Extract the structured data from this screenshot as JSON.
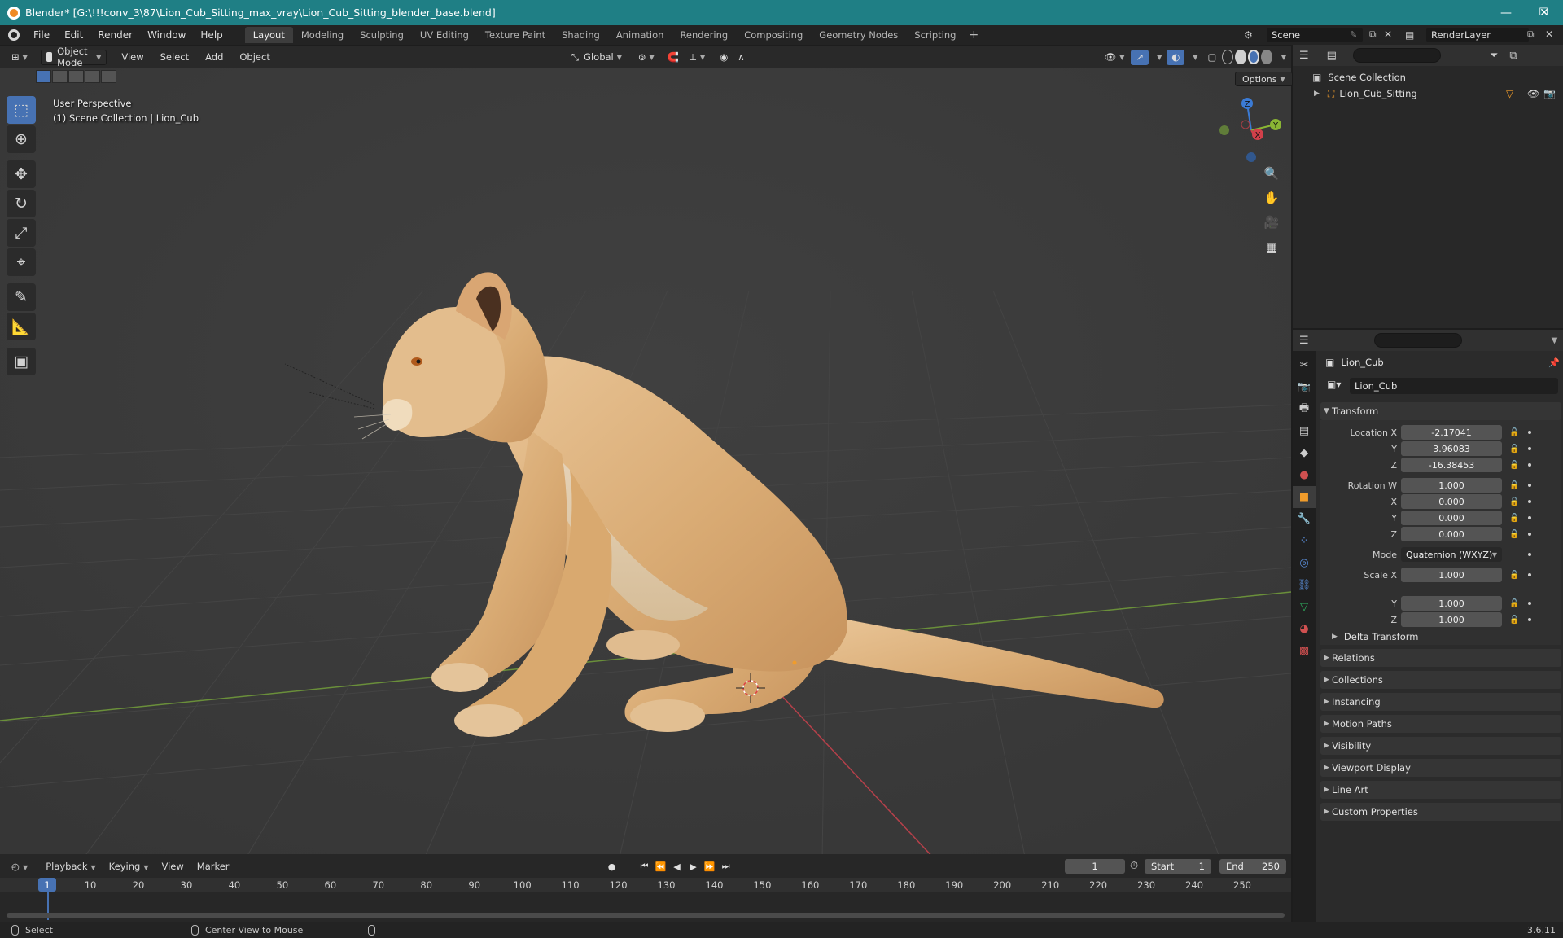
{
  "window": {
    "title": "Blender* [G:\\!!!conv_3\\87\\Lion_Cub_Sitting_max_vray\\Lion_Cub_Sitting_blender_base.blend]",
    "minimize": "—",
    "maximize": "☐",
    "close": "✕"
  },
  "menu": [
    "File",
    "Edit",
    "Render",
    "Window",
    "Help"
  ],
  "workspaces": [
    "Layout",
    "Modeling",
    "Sculpting",
    "UV Editing",
    "Texture Paint",
    "Shading",
    "Animation",
    "Rendering",
    "Compositing",
    "Geometry Nodes",
    "Scripting"
  ],
  "workspace_add": "+",
  "scene_name": "Scene",
  "view_layer": "RenderLayer",
  "viewport": {
    "mode": "Object Mode",
    "menus": [
      "View",
      "Select",
      "Add",
      "Object"
    ],
    "orientation": "Global",
    "options": "Options",
    "perspective": "User Perspective",
    "collection_info": "(1) Scene Collection | Lion_Cub",
    "gizmo_axes": {
      "x": "X",
      "y": "Y",
      "z": "Z"
    }
  },
  "outliner": {
    "root": "Scene Collection",
    "items": [
      {
        "name": "Lion_Cub_Sitting"
      }
    ]
  },
  "properties": {
    "object_name": "Lion_Cub",
    "data_name": "Lion_Cub",
    "transform": {
      "header": "Transform",
      "location": {
        "label": "Location X",
        "x": "-2.17041",
        "y": "3.96083",
        "z": "-16.38453"
      },
      "rotation": {
        "label": "Rotation W",
        "w": "1.000",
        "x": "0.000",
        "y": "0.000",
        "z": "0.000"
      },
      "mode_label": "Mode",
      "mode_value": "Quaternion (WXYZ)",
      "scale": {
        "label": "Scale X",
        "x": "1.000",
        "y": "1.000",
        "z": "1.000"
      },
      "axis_y": "Y",
      "axis_z": "Z",
      "axis_x": "X",
      "delta": "Delta Transform"
    },
    "panels": [
      "Relations",
      "Collections",
      "Instancing",
      "Motion Paths",
      "Visibility",
      "Viewport Display",
      "Line Art",
      "Custom Properties"
    ]
  },
  "timeline": {
    "menus": [
      "Playback",
      "Keying",
      "View",
      "Marker"
    ],
    "current_frame": "1",
    "start_label": "Start",
    "start": "1",
    "end_label": "End",
    "end": "250",
    "ticks": [
      "1",
      "10",
      "20",
      "30",
      "40",
      "50",
      "60",
      "70",
      "80",
      "90",
      "100",
      "110",
      "120",
      "130",
      "140",
      "150",
      "160",
      "170",
      "180",
      "190",
      "200",
      "210",
      "220",
      "230",
      "240",
      "250"
    ]
  },
  "status": {
    "select": "Select",
    "center_view": "Center View to Mouse",
    "version": "3.6.11"
  }
}
